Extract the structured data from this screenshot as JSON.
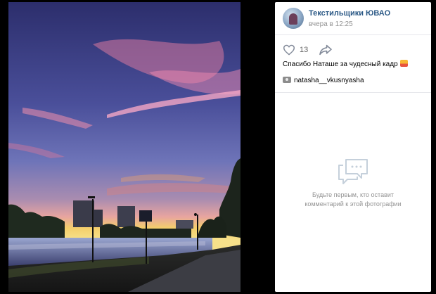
{
  "post": {
    "group_name": "Текстильщики ЮВАО",
    "time": "вчера в 12:25",
    "likes": "13",
    "caption": "Спасибо Наташе за чудесный кадр",
    "caption_emoji": "sunset-icon",
    "credit": "natasha__vkusnyasha",
    "credit_emoji": "camera-icon"
  },
  "comments": {
    "empty_text": "Будьте первым, кто оставит\nкомментарий к этой фотографии"
  },
  "colors": {
    "link": "#2a5885",
    "muted": "#939393",
    "sky_top": "#2e2f6e",
    "sky_horizon": "#f2c14e"
  }
}
